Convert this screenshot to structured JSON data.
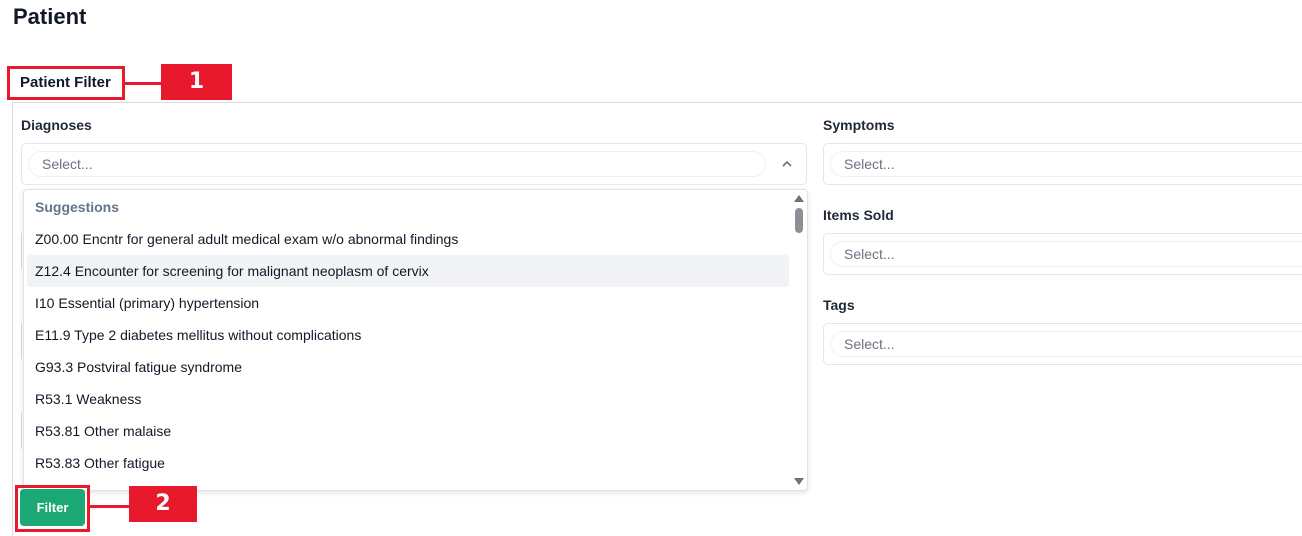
{
  "page": {
    "title": "Patient"
  },
  "filter_section": {
    "title": "Patient Filter"
  },
  "annotations": [
    {
      "number": "1"
    },
    {
      "number": "2"
    }
  ],
  "fields": {
    "diagnoses": {
      "label": "Diagnoses",
      "placeholder": "Select..."
    },
    "symptoms": {
      "label": "Symptoms",
      "placeholder": "Select..."
    },
    "items_sold": {
      "label": "Items Sold",
      "placeholder": "Select..."
    },
    "tags": {
      "label": "Tags",
      "placeholder": "Select..."
    }
  },
  "dropdown": {
    "header": "Suggestions",
    "items": [
      "Z00.00 Encntr for general adult medical exam w/o abnormal findings",
      "Z12.4 Encounter for screening for malignant neoplasm of cervix",
      "I10 Essential (primary) hypertension",
      "E11.9 Type 2 diabetes mellitus without complications",
      "G93.3 Postviral fatigue syndrome",
      "R53.1 Weakness",
      "R53.81 Other malaise",
      "R53.83 Other fatigue"
    ],
    "highlighted_index": 1
  },
  "actions": {
    "filter_label": "Filter"
  },
  "colors": {
    "accent": "#1aa874",
    "annotation": "#e8192c"
  },
  "icons": {
    "select_open": "chevron-up-icon"
  }
}
